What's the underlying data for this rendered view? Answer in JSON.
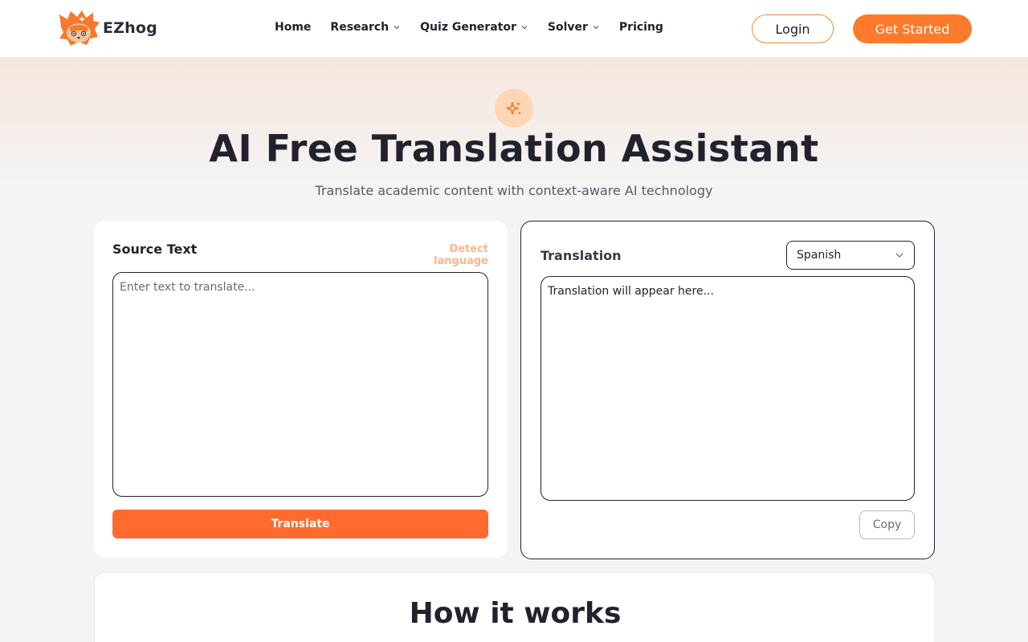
{
  "brand": {
    "name": "EZhog",
    "accent_color": "#ff7a2b",
    "logo_icon": "hedgehog-logo-icon"
  },
  "nav": {
    "items": [
      {
        "label": "Home",
        "has_dropdown": false
      },
      {
        "label": "Research",
        "has_dropdown": true
      },
      {
        "label": "Quiz Generator",
        "has_dropdown": true
      },
      {
        "label": "Solver",
        "has_dropdown": true
      },
      {
        "label": "Pricing",
        "has_dropdown": false
      }
    ],
    "login_label": "Login",
    "get_started_label": "Get Started"
  },
  "hero": {
    "icon": "sparkles-icon",
    "title": "AI Free Translation Assistant",
    "subtitle": "Translate academic content with context-aware AI technology"
  },
  "source_panel": {
    "label": "Source Text",
    "detect_label": "Detect language",
    "input_placeholder": "Enter text to translate...",
    "input_value": "",
    "translate_label": "Translate"
  },
  "translation_panel": {
    "label": "Translation",
    "selected_language": "Spanish",
    "output_text": "Translation will appear here...",
    "copy_label": "Copy"
  },
  "how_it_works": {
    "title": "How it works"
  }
}
